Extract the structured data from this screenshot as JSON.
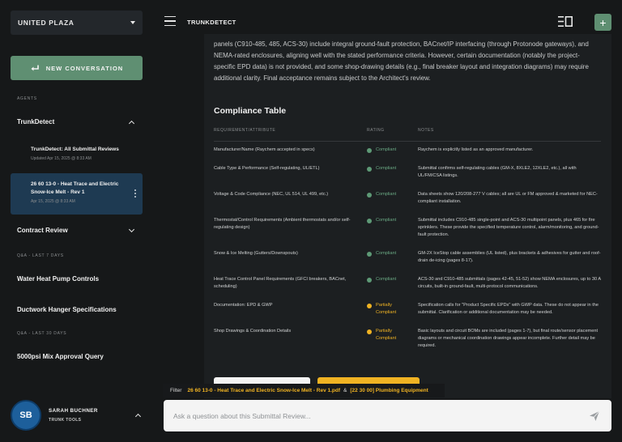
{
  "sidebar": {
    "project": "UNITED PLAZA",
    "new_conversation": "NEW CONVERSATION",
    "agents_label": "AGENTS",
    "trunkdetect": {
      "title": "TrunkDetect",
      "items": [
        {
          "title": "TrunkDetect: All Submittal Reviews",
          "date": "Updated Apr 15, 2025 @ 8:33 AM"
        },
        {
          "title": "26 60 13-0 - Heat Trace and Electric Snow-Ice Melt - Rev 1",
          "date": "Apr 15, 2025 @ 8:33 AM"
        }
      ]
    },
    "contract_review": {
      "title": "Contract Review"
    },
    "qa_7_label": "Q&A - LAST 7 DAYS",
    "qa_7_items": [
      "Water Heat Pump Controls",
      "Ductwork Hanger Specifications"
    ],
    "qa_30_label": "Q&A - LAST 30 DAYS",
    "qa_30_items": [
      "5000psi Mix Approval Query"
    ],
    "user": {
      "initials": "SB",
      "name": "SARAH BUCHNER",
      "org": "TRUNK TOOLS"
    }
  },
  "header": {
    "title": "TRUNKDETECT"
  },
  "document": {
    "intro": "panels (C910-485, 485, ACS-30) include integral ground-fault protection, BACnet/IP interfacing (through Protonode gateways), and NEMA-rated enclosures, aligning well with the stated performance criteria. However, certain documentation (notably the project-specific EPD data) is not provided, and some shop-drawing details (e.g., final breaker layout and integration diagrams) may require additional clarity. Final acceptance remains subject to the Architect's review.",
    "table_title": "Compliance Table",
    "columns": [
      "REQUIREMENT/ATTRIBUTE",
      "RATING",
      "NOTES"
    ],
    "rows": [
      {
        "req": "Manufacturer/Name (Raychem accepted in specs)",
        "rating": "Compliant",
        "status": "green",
        "notes": "Raychem is explicitly listed as an approved manufacturer."
      },
      {
        "req": "Cable Type & Performance (Self-regulating, UL/ETL)",
        "rating": "Compliant",
        "status": "green",
        "notes": "Submittal confirms self-regulating cables (GM-X, 8XLE2, 12XLE2, etc.), all with UL/FM/CSA listings."
      },
      {
        "req": "Voltage & Code Compliance (NEC, UL 514, UL 499, etc.)",
        "rating": "Compliant",
        "status": "green",
        "notes": "Data sheets show 120/208-277 V cables; all are UL or FM approved & marketed for NEC-compliant installation."
      },
      {
        "req": "Thermostat/Control Requirements (Ambient thermostats and/or self-regulating design)",
        "rating": "Compliant",
        "status": "green",
        "notes": "Submittal includes C910-485 single-point and ACS-30 multipoint panels, plus 465 for fire sprinklers. These provide the specified temperature control, alarm/monitoring, and ground-fault protection."
      },
      {
        "req": "Snow & Ice Melting (Gutters/Downspouts)",
        "rating": "Compliant",
        "status": "green",
        "notes": "GM-2X IceStop cable assemblies (UL listed), plus brackets & adhesives for gutter and roof-drain de-icing (pages 8-17)."
      },
      {
        "req": "Heat Trace Control Panel Requirements (GFCI breakers, BACnet, scheduling)",
        "rating": "Compliant",
        "status": "green",
        "notes": "ACS-30 and C910-485 submittals (pages 42-45, 51-52) show NEMA enclosures, up to 30 A circuits, built-in ground-fault, multi-protocol communications."
      },
      {
        "req": "Documentation: EPD & GWP",
        "rating": "Partially Compliant",
        "status": "amber",
        "notes": "Specification calls for \"Product Specific EPDs\" with GWP data. These do not appear in the submittal. Clarification or additional documentation may be needed."
      },
      {
        "req": "Shop Drawings & Coordination Details",
        "rating": "Partially Compliant",
        "status": "amber",
        "notes": "Basic layouts and circuit BOMs are included (pages 1-7), but final route/sensor placement diagrams or mechanical coordination drawings appear incomplete. Further detail may be required."
      }
    ]
  },
  "filter": {
    "label": "Filter",
    "doc1": "26 60 13-0 - Heat Trace and Electric Snow-Ice Melt - Rev 1.pdf",
    "amp": "&",
    "doc2": "[22 30 00] Plumbing Equipment"
  },
  "ask": {
    "placeholder": "Ask a question about this Submittal Review..."
  },
  "colors": {
    "accent_green": "#5f8f72",
    "amber": "#f0b323",
    "active_item": "#1e3a52",
    "avatar": "#1d5f9b"
  }
}
